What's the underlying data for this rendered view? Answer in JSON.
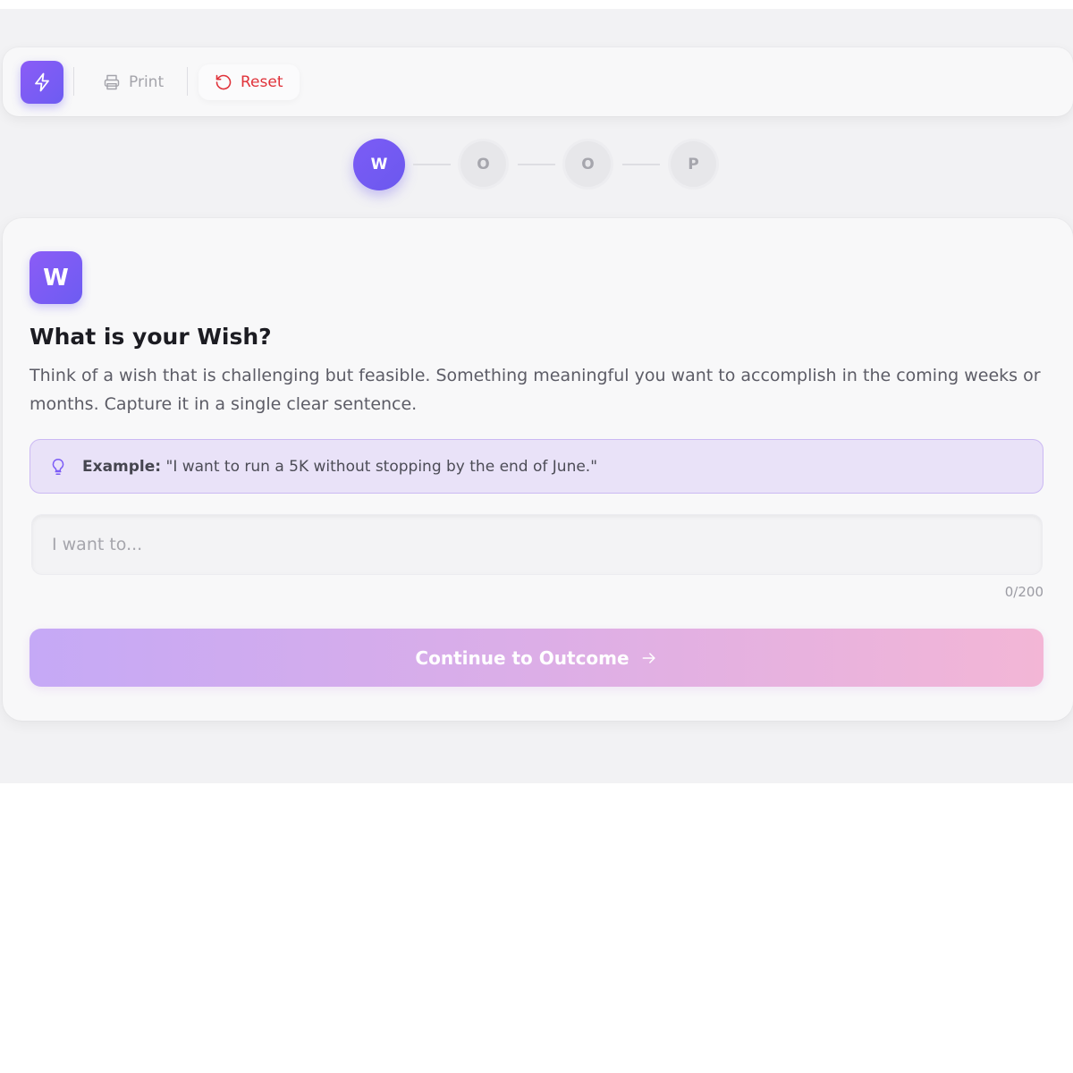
{
  "toolbar": {
    "logo_icon": "lightning-bolt-icon",
    "print_label": "Print",
    "reset_label": "Reset"
  },
  "stepper": {
    "steps": [
      {
        "letter": "W",
        "state": "active"
      },
      {
        "letter": "O",
        "state": "inactive"
      },
      {
        "letter": "O",
        "state": "inactive"
      },
      {
        "letter": "P",
        "state": "inactive"
      }
    ]
  },
  "card": {
    "badge_letter": "W",
    "title": "What is your Wish?",
    "description": "Think of a wish that is challenging but feasible. Something meaningful you want to accomplish in the coming weeks or months. Capture it in a single clear sentence.",
    "example_label": "Example:",
    "example_text": "\"I want to run a 5K without stopping by the end of June.\"",
    "input_value": "",
    "input_placeholder": "I want to...",
    "char_count": "0/200",
    "continue_label": "Continue to Outcome"
  },
  "colors": {
    "accent": "#7c5cf6",
    "reset_red": "#e0323a",
    "example_bg": "#e9e2f8"
  }
}
